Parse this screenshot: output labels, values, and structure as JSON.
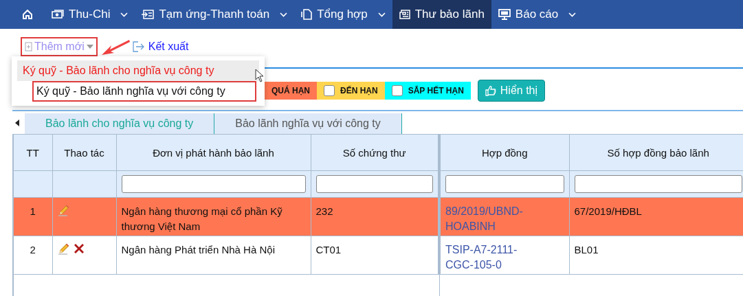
{
  "nav": [
    {
      "kind": "home",
      "selected": false
    },
    {
      "kind": "money",
      "label": "Thu-Chi",
      "dropdown": true,
      "selected": false
    },
    {
      "kind": "transfer",
      "label": "Tạm ứng-Thanh toán",
      "dropdown": true,
      "selected": false
    },
    {
      "kind": "pages",
      "label": "Tổng hợp",
      "dropdown": true,
      "selected": false
    },
    {
      "kind": "news",
      "label": "Thư bảo lãnh",
      "dropdown": false,
      "selected": true
    },
    {
      "kind": "monitor",
      "label": "Báo cáo",
      "dropdown": true,
      "selected": false
    }
  ],
  "toolbar": {
    "add_button": "Thêm mới",
    "export_link": "Kết xuất"
  },
  "add_menu": [
    {
      "label": "Ký quỹ - Bảo lãnh cho nghĩa vụ công ty",
      "hovered": true
    },
    {
      "label": "Ký quỹ - Bảo lãnh nghĩa vụ với công ty",
      "hovered": false
    }
  ],
  "filters": [
    {
      "label": "QUÁ HẠN",
      "color": "#ff7752"
    },
    {
      "label": "ĐẾN HẠN",
      "color": "#ffd54f",
      "checked": false
    },
    {
      "label": "SẮP HẾT HẠN",
      "color": "#00ffff",
      "checked": false
    }
  ],
  "show_button": "Hiển thị",
  "tabs": [
    {
      "label": "Bảo lãnh cho nghĩa vụ công ty",
      "selected": true
    },
    {
      "label": "Bảo lãnh nghĩa vụ với công ty",
      "selected": false
    }
  ],
  "table": {
    "columns": [
      {
        "label": "TT",
        "filter": false
      },
      {
        "label": "Thao tác",
        "filter": false
      },
      {
        "label": "Đơn vị phát hành bảo lãnh",
        "filter": true
      },
      {
        "label": "Số chứng thư",
        "filter": true
      },
      {
        "label": "Hợp đồng",
        "filter": true
      },
      {
        "label": "Số hợp đồng bảo lãnh",
        "filter": true
      }
    ],
    "rows": [
      {
        "tt": "1",
        "deletable": false,
        "issuer": "Ngân hàng thương mại cổ phần Kỹ thương Việt Nam",
        "cert": "232",
        "contract": "89/2019/UBND-HOABINH",
        "guarantee": "67/2019/HĐBL",
        "selected": true
      },
      {
        "tt": "2",
        "deletable": true,
        "issuer": "Ngân hàng Phát triển Nhà Hà Nội",
        "cert": "CT01",
        "contract": "TSIP-A7-2111-CGC-105-0",
        "guarantee": "BL01",
        "selected": false
      }
    ]
  }
}
